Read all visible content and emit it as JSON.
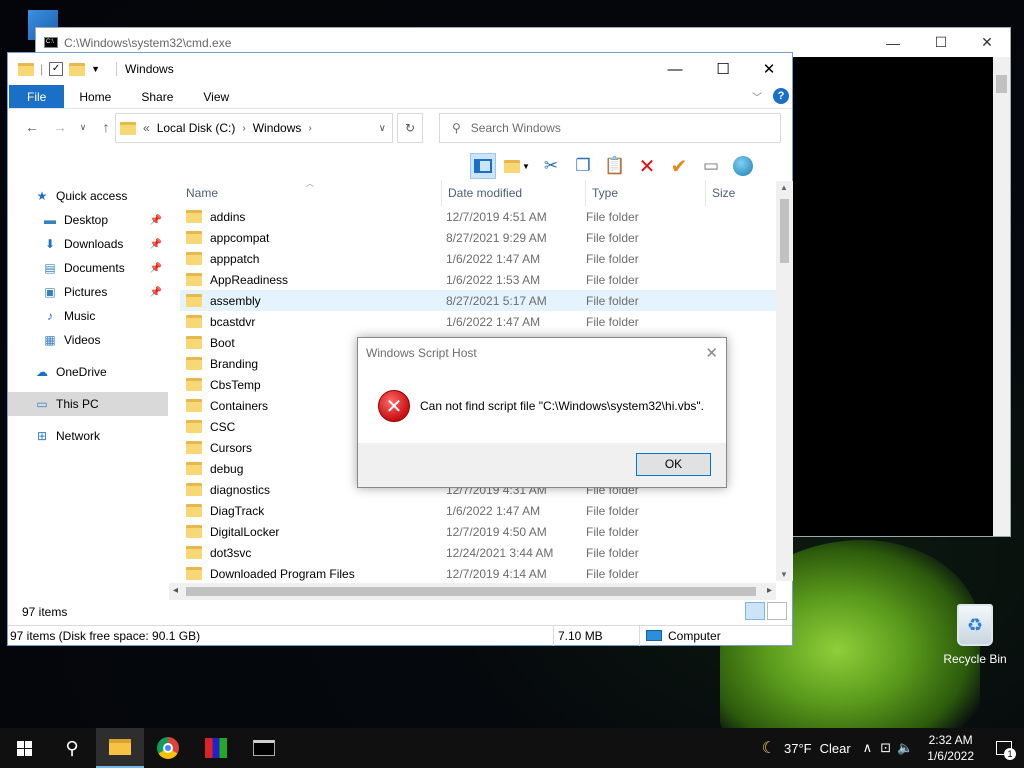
{
  "desktop": {
    "recycle_label": "Recycle Bin"
  },
  "cmd": {
    "title": "C:\\Windows\\system32\\cmd.exe"
  },
  "explorer": {
    "title": "Windows",
    "tabs": [
      "File",
      "Home",
      "Share",
      "View"
    ],
    "help": "?",
    "address": {
      "prefix": "«",
      "crumbs": [
        "Local Disk (C:)",
        "Windows"
      ]
    },
    "search_placeholder": "Search Windows",
    "nav": [
      {
        "label": "Quick access",
        "icon": "★",
        "indent": 26
      },
      {
        "label": "Desktop",
        "icon": "▬",
        "indent": 34,
        "pinned": true
      },
      {
        "label": "Downloads",
        "icon": "⬇",
        "indent": 34,
        "pinned": true
      },
      {
        "label": "Documents",
        "icon": "▤",
        "indent": 34,
        "pinned": true
      },
      {
        "label": "Pictures",
        "icon": "▣",
        "indent": 34,
        "pinned": true
      },
      {
        "label": "Music",
        "icon": "♪",
        "indent": 34
      },
      {
        "label": "Videos",
        "icon": "▦",
        "indent": 34
      },
      {
        "label": "OneDrive",
        "icon": "☁",
        "indent": 26
      },
      {
        "label": "This PC",
        "icon": "▭",
        "indent": 26,
        "selected": true
      },
      {
        "label": "Network",
        "icon": "⊞",
        "indent": 26
      }
    ],
    "columns": [
      "Name",
      "Date modified",
      "Type",
      "Size"
    ],
    "rows": [
      {
        "name": "addins",
        "date": "12/7/2019 4:51 AM",
        "type": "File folder"
      },
      {
        "name": "appcompat",
        "date": "8/27/2021 9:29 AM",
        "type": "File folder"
      },
      {
        "name": "apppatch",
        "date": "1/6/2022 1:47 AM",
        "type": "File folder"
      },
      {
        "name": "AppReadiness",
        "date": "1/6/2022 1:53 AM",
        "type": "File folder"
      },
      {
        "name": "assembly",
        "date": "8/27/2021 5:17 AM",
        "type": "File folder",
        "hover": true
      },
      {
        "name": "bcastdvr",
        "date": "1/6/2022 1:47 AM",
        "type": "File folder"
      },
      {
        "name": "Boot",
        "date": "",
        "type": ""
      },
      {
        "name": "Branding",
        "date": "",
        "type": ""
      },
      {
        "name": "CbsTemp",
        "date": "",
        "type": ""
      },
      {
        "name": "Containers",
        "date": "",
        "type": ""
      },
      {
        "name": "CSC",
        "date": "",
        "type": ""
      },
      {
        "name": "Cursors",
        "date": "",
        "type": ""
      },
      {
        "name": "debug",
        "date": "",
        "type": ""
      },
      {
        "name": "diagnostics",
        "date": "12/7/2019 4:31 AM",
        "type": "File folder"
      },
      {
        "name": "DiagTrack",
        "date": "1/6/2022 1:47 AM",
        "type": "File folder"
      },
      {
        "name": "DigitalLocker",
        "date": "12/7/2019 4:50 AM",
        "type": "File folder"
      },
      {
        "name": "dot3svc",
        "date": "12/24/2021 3:44 AM",
        "type": "File folder"
      },
      {
        "name": "Downloaded Program Files",
        "date": "12/7/2019 4:14 AM",
        "type": "File folder"
      }
    ],
    "item_count": "97 items",
    "status": {
      "summary": "97 items (Disk free space: 90.1 GB)",
      "size": "7.10 MB",
      "location": "Computer"
    }
  },
  "dialog": {
    "title": "Windows Script Host",
    "message": "Can not find script file \"C:\\Windows\\system32\\hi.vbs\".",
    "ok_label": "OK"
  },
  "taskbar": {
    "weather": {
      "temp": "37°F",
      "condition": "Clear"
    },
    "time": "2:32 AM",
    "date": "1/6/2022",
    "notifications": "1"
  },
  "colors": {
    "accent": "#1a6fc6",
    "folder": "#f8d775",
    "error": "#c80f0f"
  }
}
